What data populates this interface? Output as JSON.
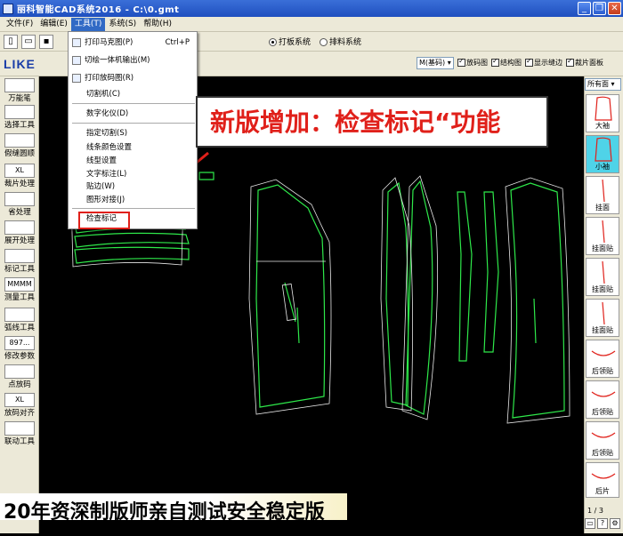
{
  "window": {
    "title": "丽科智能CAD系统2016 - C:\\0.gmt",
    "minimize": "_",
    "restore": "❐",
    "close": "✕"
  },
  "menubar": {
    "items": [
      "文件(F)",
      "编辑(E)",
      "工具(T)",
      "系统(S)",
      "帮助(H)"
    ]
  },
  "toolbar": {
    "radio_options": [
      "打板系统",
      "排料系统"
    ]
  },
  "brand": {
    "logo": "LIKE"
  },
  "options": {
    "size_select": "M(基码)",
    "checkboxes": [
      "放码图",
      "结构图",
      "显示缝边",
      "裁片面板"
    ]
  },
  "left_tools": [
    {
      "label": "万能笔",
      "icon": "pen-icon"
    },
    {
      "label": "选择工具",
      "icon": "select-icon"
    },
    {
      "label": "假缝圆顺",
      "icon": "seam-icon"
    },
    {
      "label": "裁片处理",
      "icon": "piece-icon",
      "icon_text": "XL"
    },
    {
      "label": "省处理",
      "icon": "dart-icon"
    },
    {
      "label": "展开处理",
      "icon": "expand-icon"
    },
    {
      "label": "标记工具",
      "icon": "mark-icon"
    },
    {
      "label": "测量工具",
      "icon": "ruler-icon",
      "icon_text": "MMMM"
    },
    {
      "label": "弧线工具",
      "icon": "arc-icon"
    },
    {
      "label": "修改参数",
      "icon": "param-icon",
      "icon_text": "897..."
    },
    {
      "label": "点放码",
      "icon": "grade-icon"
    },
    {
      "label": "放码对齐",
      "icon": "align-icon",
      "icon_text": "XL"
    },
    {
      "label": "联动工具",
      "icon": "link-icon"
    }
  ],
  "tools_menu": {
    "items": [
      {
        "label": "打印马克图(P)",
        "shortcut": "Ctrl+P",
        "icon": true
      },
      {
        "label": "切绘一体机输出(M)",
        "shortcut": "",
        "icon": true
      },
      {
        "label": "打印放码图(R)",
        "shortcut": "",
        "icon": true
      },
      {
        "label": "切割机(C)",
        "shortcut": "",
        "icon": false
      },
      {
        "label": "数字化仪(D)",
        "shortcut": "",
        "icon": false
      },
      {
        "label": "指定切割(S)",
        "shortcut": "",
        "icon": false
      },
      {
        "label": "线条颜色设置",
        "shortcut": "",
        "icon": false
      },
      {
        "label": "线型设置",
        "shortcut": "",
        "icon": false
      },
      {
        "label": "文字标注(L)",
        "shortcut": "",
        "icon": false
      },
      {
        "label": "贴边(W)",
        "shortcut": "",
        "icon": false
      },
      {
        "label": "图形对接(J)",
        "shortcut": "",
        "icon": false
      },
      {
        "label": "检查标记",
        "shortcut": "",
        "icon": false
      }
    ]
  },
  "annotation": {
    "callout": "新版增加：检查标记“功能",
    "banner": "20年资深制版师亲自测试安全稳定版"
  },
  "right_panel": {
    "filter": "所有面",
    "pieces": [
      "大袖",
      "小袖",
      "挂面",
      "挂面贴",
      "挂面贴",
      "挂面贴",
      "后领贴",
      "后领贴",
      "后领贴",
      "后片"
    ],
    "pager": "1 / 3"
  },
  "colors": {
    "titlebar": "#2a5ccf",
    "menu_highlight": "#316ac5",
    "pattern_green": "#2ee84a",
    "pattern_grid": "#e8e8e8",
    "callout_red": "#e0201a",
    "selected_piece": "#4fd3e8"
  }
}
